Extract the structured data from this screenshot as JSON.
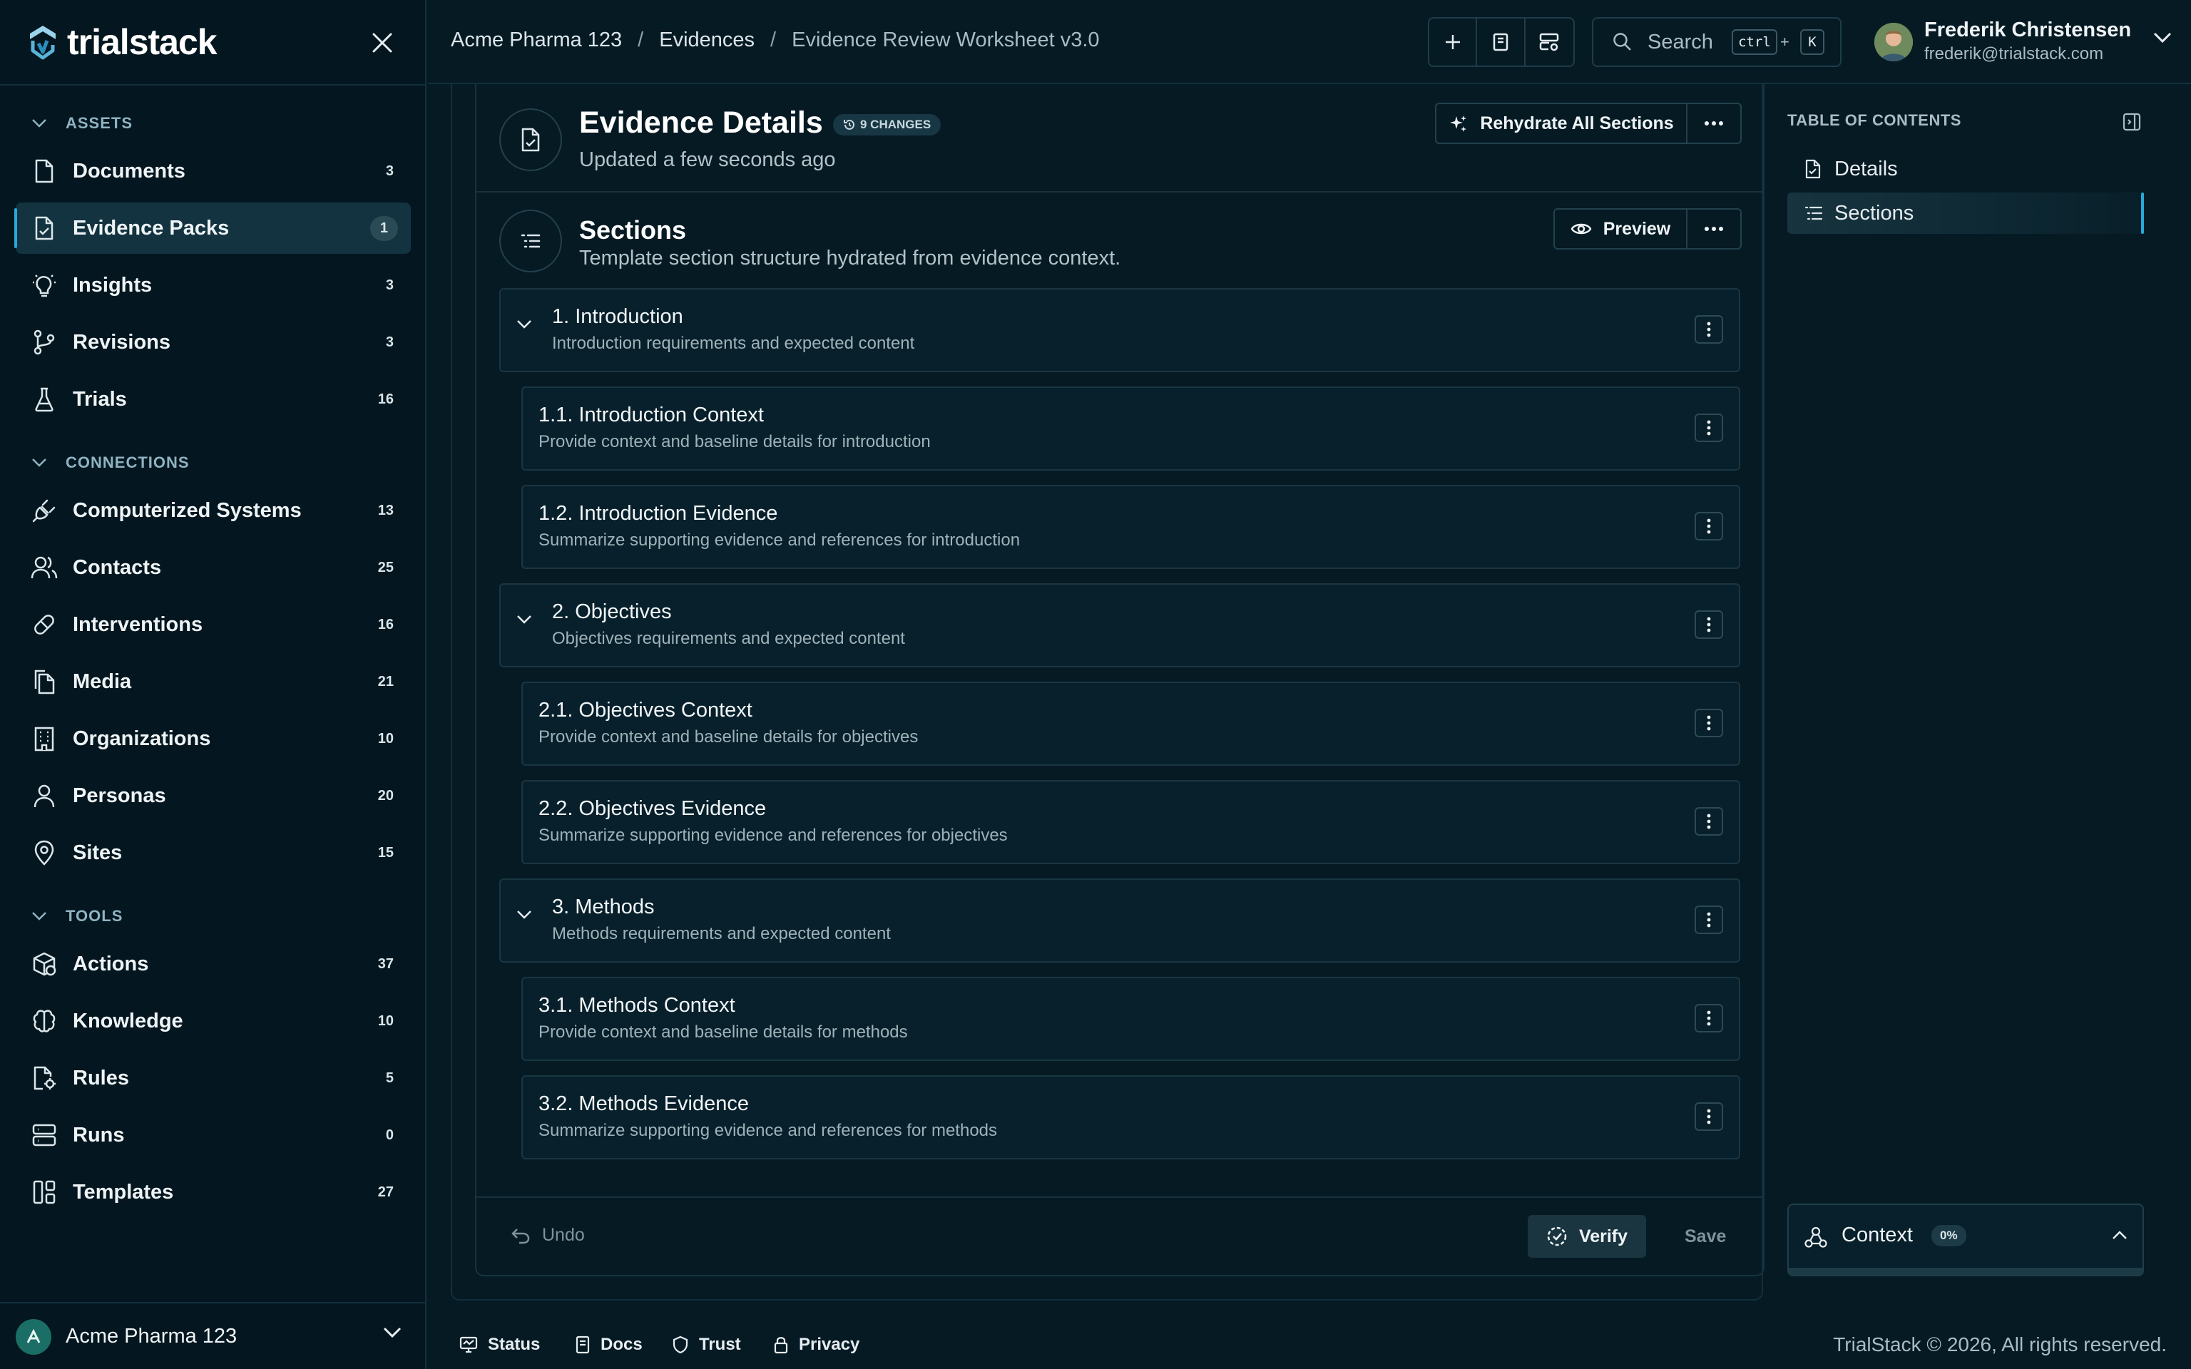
{
  "app": {
    "name": "trialstack"
  },
  "sidebar": {
    "sections": [
      {
        "title": "ASSETS"
      },
      {
        "title": "CONNECTIONS"
      },
      {
        "title": "TOOLS"
      }
    ],
    "items": [
      {
        "label": "Documents",
        "count": "3",
        "icon": "file-icon"
      },
      {
        "label": "Evidence Packs",
        "count": "1",
        "icon": "file-check-icon",
        "active": true
      },
      {
        "label": "Insights",
        "count": "3",
        "icon": "lightbulb-icon"
      },
      {
        "label": "Revisions",
        "count": "3",
        "icon": "git-branch-icon"
      },
      {
        "label": "Trials",
        "count": "16",
        "icon": "flask-icon"
      },
      {
        "label": "Computerized Systems",
        "count": "13",
        "icon": "plug-icon"
      },
      {
        "label": "Contacts",
        "count": "25",
        "icon": "users-icon"
      },
      {
        "label": "Interventions",
        "count": "16",
        "icon": "pill-icon"
      },
      {
        "label": "Media",
        "count": "21",
        "icon": "files-icon"
      },
      {
        "label": "Organizations",
        "count": "10",
        "icon": "building-icon"
      },
      {
        "label": "Personas",
        "count": "20",
        "icon": "user-icon"
      },
      {
        "label": "Sites",
        "count": "15",
        "icon": "map-pin-icon"
      },
      {
        "label": "Actions",
        "count": "37",
        "icon": "package-icon"
      },
      {
        "label": "Knowledge",
        "count": "10",
        "icon": "brain-icon"
      },
      {
        "label": "Rules",
        "count": "5",
        "icon": "file-cog-icon"
      },
      {
        "label": "Runs",
        "count": "0",
        "icon": "server-icon"
      },
      {
        "label": "Templates",
        "count": "27",
        "icon": "layout-icon"
      }
    ],
    "org": {
      "name": "Acme Pharma 123"
    }
  },
  "topbar": {
    "breadcrumb": [
      "Acme Pharma 123",
      "Evidences",
      "Evidence Review Worksheet v3.0"
    ],
    "search": {
      "label": "Search",
      "key1": "ctrl",
      "plus": "+",
      "key2": "K"
    },
    "user": {
      "name": "Frederik Christensen",
      "email": "frederik@trialstack.com"
    }
  },
  "details": {
    "title": "Evidence Details",
    "changes": "9 CHANGES",
    "updated": "Updated a few seconds ago",
    "rehydrate_label": "Rehydrate All Sections"
  },
  "sections": {
    "title": "Sections",
    "subtitle": "Template section structure hydrated from evidence context.",
    "preview_label": "Preview",
    "rows": [
      {
        "title": "1. Introduction",
        "subtitle": "Introduction requirements and expected content",
        "level": 1
      },
      {
        "title": "1.1. Introduction Context",
        "subtitle": "Provide context and baseline details for introduction",
        "level": 2
      },
      {
        "title": "1.2. Introduction Evidence",
        "subtitle": "Summarize supporting evidence and references for introduction",
        "level": 2
      },
      {
        "title": "2. Objectives",
        "subtitle": "Objectives requirements and expected content",
        "level": 1
      },
      {
        "title": "2.1. Objectives Context",
        "subtitle": "Provide context and baseline details for objectives",
        "level": 2
      },
      {
        "title": "2.2. Objectives Evidence",
        "subtitle": "Summarize supporting evidence and references for objectives",
        "level": 2
      },
      {
        "title": "3. Methods",
        "subtitle": "Methods requirements and expected content",
        "level": 1
      },
      {
        "title": "3.1. Methods Context",
        "subtitle": "Provide context and baseline details for methods",
        "level": 2
      },
      {
        "title": "3.2. Methods Evidence",
        "subtitle": "Summarize supporting evidence and references for methods",
        "level": 2
      }
    ]
  },
  "footer_actions": {
    "undo": "Undo",
    "verify": "Verify",
    "save": "Save"
  },
  "toc": {
    "title": "TABLE OF CONTENTS",
    "items": [
      {
        "label": "Details"
      },
      {
        "label": "Sections",
        "active": true
      }
    ]
  },
  "context": {
    "label": "Context",
    "percent": "0%"
  },
  "bottom": {
    "links": [
      "Status",
      "Docs",
      "Trust",
      "Privacy"
    ],
    "copyright": "TrialStack © 2026, All rights reserved."
  },
  "colors": {
    "accent": "#2aa8d8",
    "background": "#061a24",
    "sidebar": "#04161f"
  }
}
